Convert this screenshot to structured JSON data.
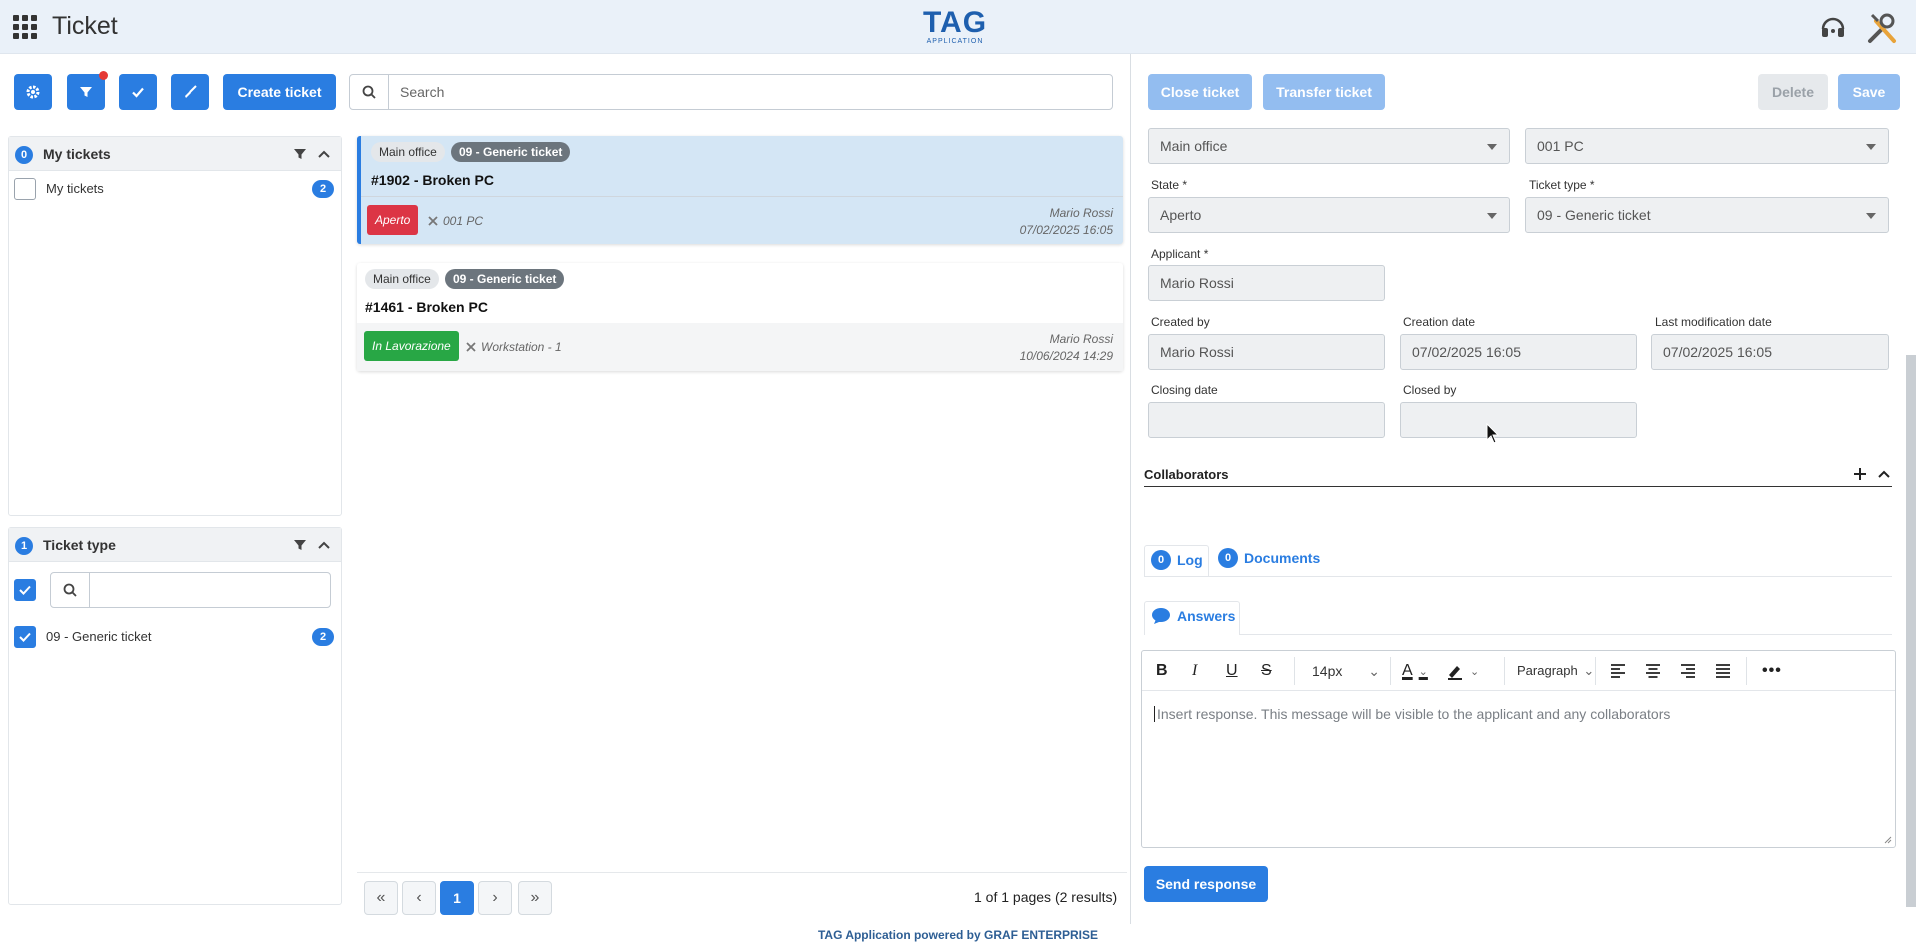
{
  "header": {
    "title": "Ticket",
    "logo_main": "TAG",
    "logo_sub": "APPLICATION"
  },
  "toolbar": {
    "create_label": "Create ticket",
    "search_placeholder": "Search"
  },
  "my_tickets_panel": {
    "count": "0",
    "title": "My tickets",
    "items": [
      {
        "label": "My tickets",
        "count": "2",
        "checked": false
      }
    ]
  },
  "ticket_type_panel": {
    "count": "1",
    "title": "Ticket type",
    "items": [
      {
        "label": "09 - Generic ticket",
        "count": "2",
        "checked": true
      }
    ]
  },
  "tickets": [
    {
      "location": "Main office",
      "type": "09 - Generic ticket",
      "title": "#1902 - Broken PC",
      "status": "Aperto",
      "asset": "001 PC",
      "author": "Mario Rossi",
      "date": "07/02/2025 16:05"
    },
    {
      "location": "Main office",
      "type": "09 - Generic ticket",
      "title": "#1461 - Broken PC",
      "status": "In Lavorazione",
      "asset": "Workstation - 1",
      "author": "Mario Rossi",
      "date": "10/06/2024 14:29"
    }
  ],
  "pagination": {
    "current": "1",
    "info": "1 of 1 pages (2 results)"
  },
  "detail": {
    "close_label": "Close ticket",
    "transfer_label": "Transfer ticket",
    "delete_label": "Delete",
    "save_label": "Save",
    "location": "Main office",
    "asset": "001 PC",
    "state_label": "State *",
    "state_value": "Aperto",
    "type_label": "Ticket type *",
    "type_value": "09 - Generic ticket",
    "applicant_label": "Applicant *",
    "applicant_value": "Mario Rossi",
    "created_by_label": "Created by",
    "created_by_value": "Mario Rossi",
    "creation_date_label": "Creation date",
    "creation_date_value": "07/02/2025 16:05",
    "last_mod_label": "Last modification date",
    "last_mod_value": "07/02/2025 16:05",
    "closing_date_label": "Closing date",
    "closing_date_value": "",
    "closed_by_label": "Closed by",
    "closed_by_value": "",
    "collaborators_label": "Collaborators",
    "tabs": [
      {
        "count": "0",
        "label": "Log"
      },
      {
        "count": "0",
        "label": "Documents"
      }
    ],
    "answers_label": "Answers",
    "editor": {
      "font_size": "14px",
      "block_format": "Paragraph",
      "placeholder": "Insert response. This message will be visible to the applicant and any collaborators"
    },
    "send_label": "Send response"
  },
  "footer": {
    "text": "TAG Application powered by GRAF ENTERPRISE"
  },
  "colors": {
    "primary": "#2a7de1",
    "status_open": "#dc3545",
    "status_progress": "#28a745",
    "selected_ticket": "#d4e6f5"
  }
}
